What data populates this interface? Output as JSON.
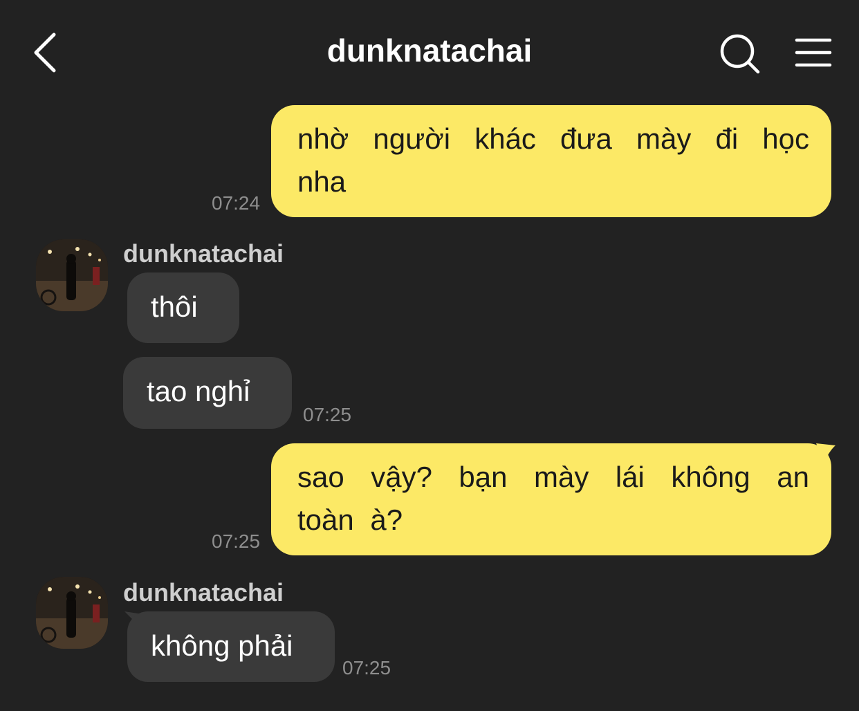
{
  "header": {
    "title": "dunknatachai",
    "back_icon": "chevron-left-icon",
    "search_icon": "search-icon",
    "menu_icon": "hamburger-menu-icon"
  },
  "colors": {
    "background": "#222222",
    "outgoing_bubble": "#FCE966",
    "incoming_bubble": "#3a3a3a",
    "timestamp": "#8e8e8e"
  },
  "messages": [
    {
      "direction": "outgoing",
      "text": "nhờ người khác đưa mày đi học nha",
      "time": "07:24"
    },
    {
      "direction": "incoming",
      "sender": "dunknatachai",
      "text": "thôi"
    },
    {
      "direction": "incoming",
      "text": "tao nghỉ",
      "time": "07:25"
    },
    {
      "direction": "outgoing",
      "text": "sao vậy? bạn mày lái không an toàn à?",
      "time": "07:25"
    },
    {
      "direction": "incoming",
      "sender": "dunknatachai",
      "text": "không phải",
      "time": "07:25"
    }
  ]
}
